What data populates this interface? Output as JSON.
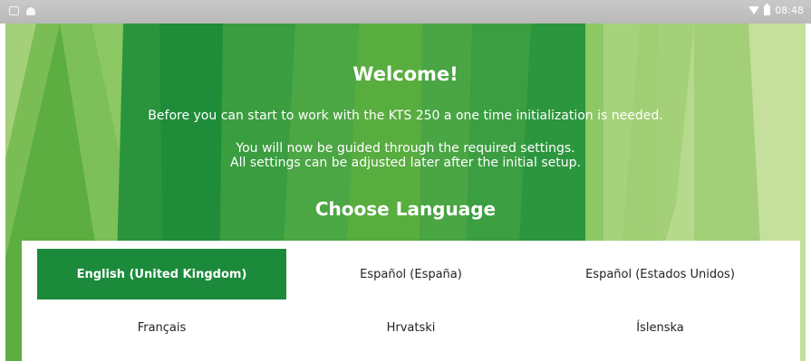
{
  "status_bar": {
    "time": "08:48",
    "left_icons": [
      "window-icon",
      "android-icon"
    ],
    "right_icons": [
      "wifi-icon",
      "battery-icon"
    ]
  },
  "header": {
    "title": "Welcome!",
    "intro": "Before you can start to work with the KTS 250 a one time initialization is needed.",
    "guide_line1": "You will now be guided through the required settings.",
    "guide_line2": "All settings can be adjusted later after the initial setup."
  },
  "language_section": {
    "title": "Choose Language",
    "selected": "English (United Kingdom)",
    "options": [
      {
        "label": "English (United Kingdom)"
      },
      {
        "label": "Español (España)"
      },
      {
        "label": "Español (Estados Unidos)"
      },
      {
        "label": "Français"
      },
      {
        "label": "Hrvatski"
      },
      {
        "label": "Íslenska"
      }
    ]
  },
  "colors": {
    "accent": "#1b8a3b",
    "background_green": "#58ad3f",
    "status_bar": "#c0c0c0"
  }
}
